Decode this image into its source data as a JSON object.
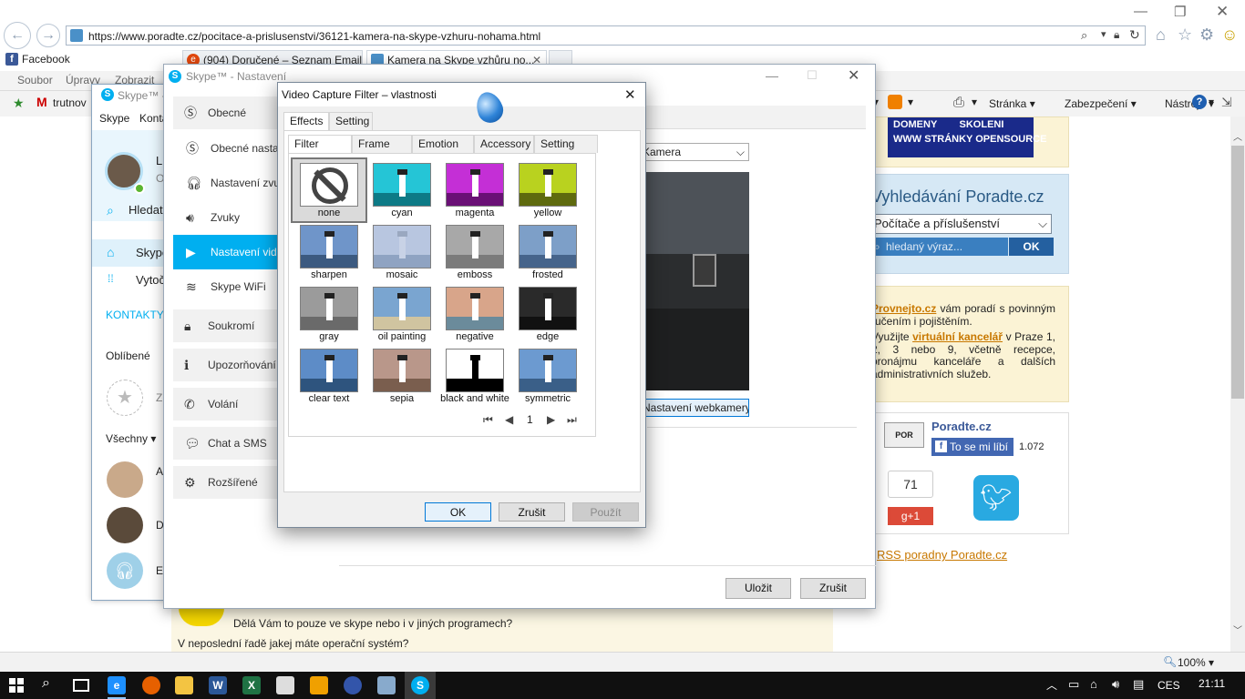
{
  "browser": {
    "url": "https://www.poradte.cz/pocitace-a-prislusenstvi/36121-kamera-na-skype-vzhuru-nohama.html",
    "tabs": [
      {
        "label": "Facebook"
      },
      {
        "label": "(904) Doručené – Seznam Email"
      },
      {
        "label": "Kamera na Skype vzhůru no...",
        "close": "✕"
      }
    ],
    "menu": [
      "Soubor",
      "Úpravy",
      "Zobrazit"
    ],
    "favorites_item": "trutnov",
    "commands": [
      "Stránka",
      "Zabezpečení",
      "Nástroje"
    ],
    "zoom": "100%"
  },
  "page": {
    "banner_lines": [
      "DOMENY        SKOLENI",
      "WWW STRÁNKY OPENSOURCE"
    ],
    "search_title": "Vyhledávání Poradte.cz",
    "search_category": "Počítače a příslušenství",
    "search_placeholder": "hledaný výraz...",
    "search_button": "OK",
    "ad": {
      "link1": "Provnejto.cz",
      "text1": " vám poradí s povinným ručením i pojištěním.",
      "text2a": "Využijte ",
      "link2": "virtuální kancelář",
      "text2b": " v Praze 1, 2, 3 nebo 9, včetně recepce, pronájmu kanceláře a dalších administrativních služeb."
    },
    "social": {
      "name": "Poradte.cz",
      "like_label": "To se mi líbí",
      "like_count": "1.072",
      "gplus_count": "71",
      "gplus_label": "g+1"
    },
    "rss": "RSS poradny Poradte.cz",
    "comment1": "Dělá Vám to pouze ve skype nebo i v jiných programech?",
    "comment2": "V neposlední řadě jakej máte operační systém?"
  },
  "skype": {
    "title": "Skype™ -",
    "menu": [
      "Skype",
      "Konta"
    ],
    "user_initial": "Li",
    "user_status": "O",
    "search": "Hledat",
    "nav_home": "Skype",
    "nav_call": "Vytoč",
    "contacts_header": "KONTAKTY",
    "favorites": "Oblíbené",
    "fav_prefix": "Z",
    "all_label": "Všechny",
    "contacts": [
      "A",
      "D",
      "E"
    ]
  },
  "settings": {
    "title": "Skype™ - Nastavení",
    "categories": [
      {
        "label": "Obecné",
        "icon": "skype-icon"
      },
      {
        "label": "Soukromí",
        "icon": "lock-icon"
      },
      {
        "label": "Upozorňování",
        "icon": "info-icon"
      },
      {
        "label": "Volání",
        "icon": "phone-icon"
      },
      {
        "label": "Chat a SMS",
        "icon": "chat-icon"
      },
      {
        "label": "Rozšířené",
        "icon": "gear-icon"
      }
    ],
    "subitems": [
      {
        "label": "Obecné nastavení",
        "icon": "skype-icon"
      },
      {
        "label": "Nastavení zvuku",
        "icon": "headset-icon"
      },
      {
        "label": "Zvuky",
        "icon": "speaker-icon"
      },
      {
        "label": "Nastavení videa",
        "icon": "camera-icon"
      },
      {
        "label": "Skype WiFi",
        "icon": "wifi-icon"
      }
    ],
    "camera_select": "Kamera",
    "webcam_button": "Nastavení webkamery",
    "save_button": "Uložit",
    "cancel_button": "Zrušit"
  },
  "dialog": {
    "title": "Video Capture Filter – vlastnosti",
    "tabs": [
      "Effects",
      "Setting"
    ],
    "subtabs": [
      "Filter",
      "Frame",
      "Emotion",
      "Accessory",
      "Setting"
    ],
    "filters": [
      {
        "label": "none"
      },
      {
        "label": "cyan"
      },
      {
        "label": "magenta"
      },
      {
        "label": "yellow"
      },
      {
        "label": "sharpen"
      },
      {
        "label": "mosaic"
      },
      {
        "label": "emboss"
      },
      {
        "label": "frosted"
      },
      {
        "label": "gray"
      },
      {
        "label": "oil painting"
      },
      {
        "label": "negative"
      },
      {
        "label": "edge"
      },
      {
        "label": "clear text"
      },
      {
        "label": "sepia"
      },
      {
        "label": "black and white"
      },
      {
        "label": "symmetric"
      }
    ],
    "page": "1",
    "ok": "OK",
    "cancel": "Zrušit",
    "apply": "Použít"
  },
  "taskbar": {
    "lang": "CES",
    "time": "21:11"
  },
  "colors": {
    "skype_blue": "#00aff0",
    "page_link": "#c87800",
    "fb_blue": "#3b5998",
    "twitter_blue": "#29a9e1"
  }
}
